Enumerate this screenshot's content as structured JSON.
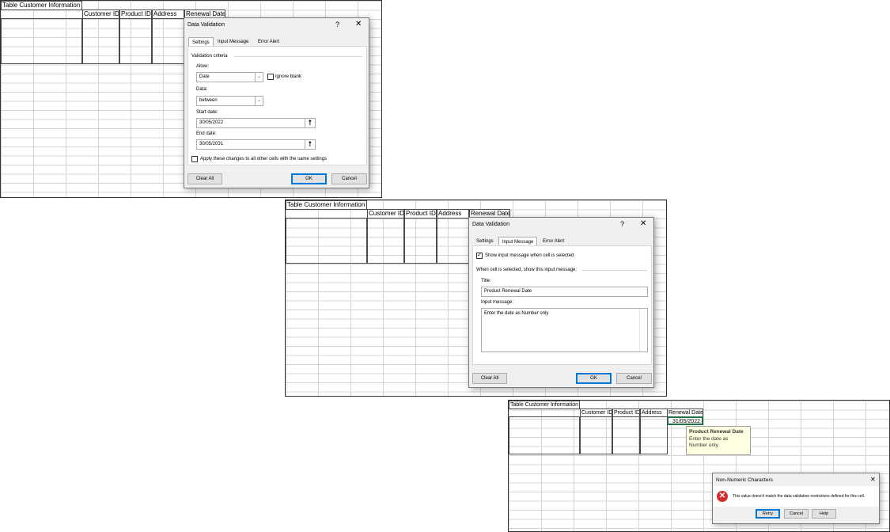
{
  "table": {
    "title": "Table Customer Information",
    "headers": [
      "Customer ID",
      "Product ID",
      "Address",
      "Renewal Date"
    ]
  },
  "dialog_settings": {
    "title": "Data Validation",
    "help": "?",
    "close": "✕",
    "tabs": [
      "Settings",
      "Input Message",
      "Error Alert"
    ],
    "section": "Validation criteria",
    "allow_label": "Allow:",
    "allow_value": "Date",
    "ignore_blank": "Ignore blank",
    "data_label": "Data:",
    "data_value": "between",
    "start_label": "Start date:",
    "start_value": "30/05/2022",
    "end_label": "End date:",
    "end_value": "30/05/2031",
    "apply_label": "Apply these changes to all other cells with the same settings",
    "clear_all": "Clear All",
    "ok": "OK",
    "cancel": "Cancel",
    "picker_glyph": "⭡",
    "dropdown_glyph": "⌄"
  },
  "dialog_input": {
    "title": "Data Validation",
    "help": "?",
    "close": "✕",
    "tabs": [
      "Settings",
      "Input Message",
      "Error Alert"
    ],
    "show_label": "Show input message when cell is selected",
    "show_checked": "✓",
    "when_label": "When cell is selected, show this input message:",
    "title_label": "Title:",
    "title_value": "Product Renewal Date",
    "message_label": "Input message:",
    "message_value": "Enter the date as Number only",
    "clear_all": "Clear All",
    "ok": "OK",
    "cancel": "Cancel"
  },
  "panel3": {
    "cell_value": "31/05/2022",
    "tooltip_title": "Product Renewal Date",
    "tooltip_body": "Enter the date as Number only"
  },
  "error_dialog": {
    "title": "Non-Numeric Characters",
    "close": "✕",
    "icon": "✕",
    "message": "This value doesn't match the data validation restrictions defined for this cell.",
    "retry": "Retry",
    "cancel": "Cancel",
    "help": "Help"
  }
}
